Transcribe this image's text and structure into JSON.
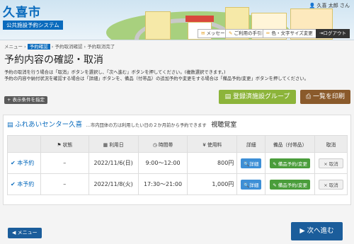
{
  "header": {
    "site_name": "久喜市",
    "site_sub": "公共施設予約システム",
    "user": "久喜 太郎 さん",
    "buttons": [
      "メッセージ",
      "ご利用の手引き",
      "色・文字サイズ変更",
      "ログアウト"
    ]
  },
  "breadcrumb": [
    "メニュー",
    "予約確認",
    "予約取消確認",
    "予約取消完了"
  ],
  "page_title": "予約内容の確認・取消",
  "description": [
    "予約の取消を行う場合は「取消」ボタンを選択し、「次へ進む」ボタンを押してください。(複数選択できます。)",
    "予約の内容や納付状況を確認する場合は「詳細」ボタンを、備品（付帯品）の追加予約や変更をする場合は「備品予約/変更」ボタンを押してください。"
  ],
  "actions": {
    "conditions": "+ 表示条件を指定",
    "registered_group": "登録済施設グループ",
    "print_list": "一覧を印刷"
  },
  "facility": {
    "name": "ふれあいセンター久喜",
    "note": "…市内団体の方は利用したい日の２か月前から予約できます",
    "room": "視聴覚室"
  },
  "table": {
    "headers": [
      "状態",
      "利用日",
      "時間帯",
      "使用料",
      "詳細",
      "備品（付帯品）",
      "取消"
    ],
    "rows": [
      {
        "status": "本予約",
        "flag": "–",
        "date": "2022/11/6(日)",
        "time": "9:00～12:00",
        "fee": "800円",
        "detail": "詳細",
        "equipment": "備品予約/変更",
        "cancel": "取消"
      },
      {
        "status": "本予約",
        "flag": "–",
        "date": "2022/11/8(火)",
        "time": "17:30～21:00",
        "fee": "1,000円",
        "detail": "詳細",
        "equipment": "備品予約/変更",
        "cancel": "取消"
      }
    ]
  },
  "footer": {
    "menu": "メニュー",
    "next": "次へ進む"
  }
}
